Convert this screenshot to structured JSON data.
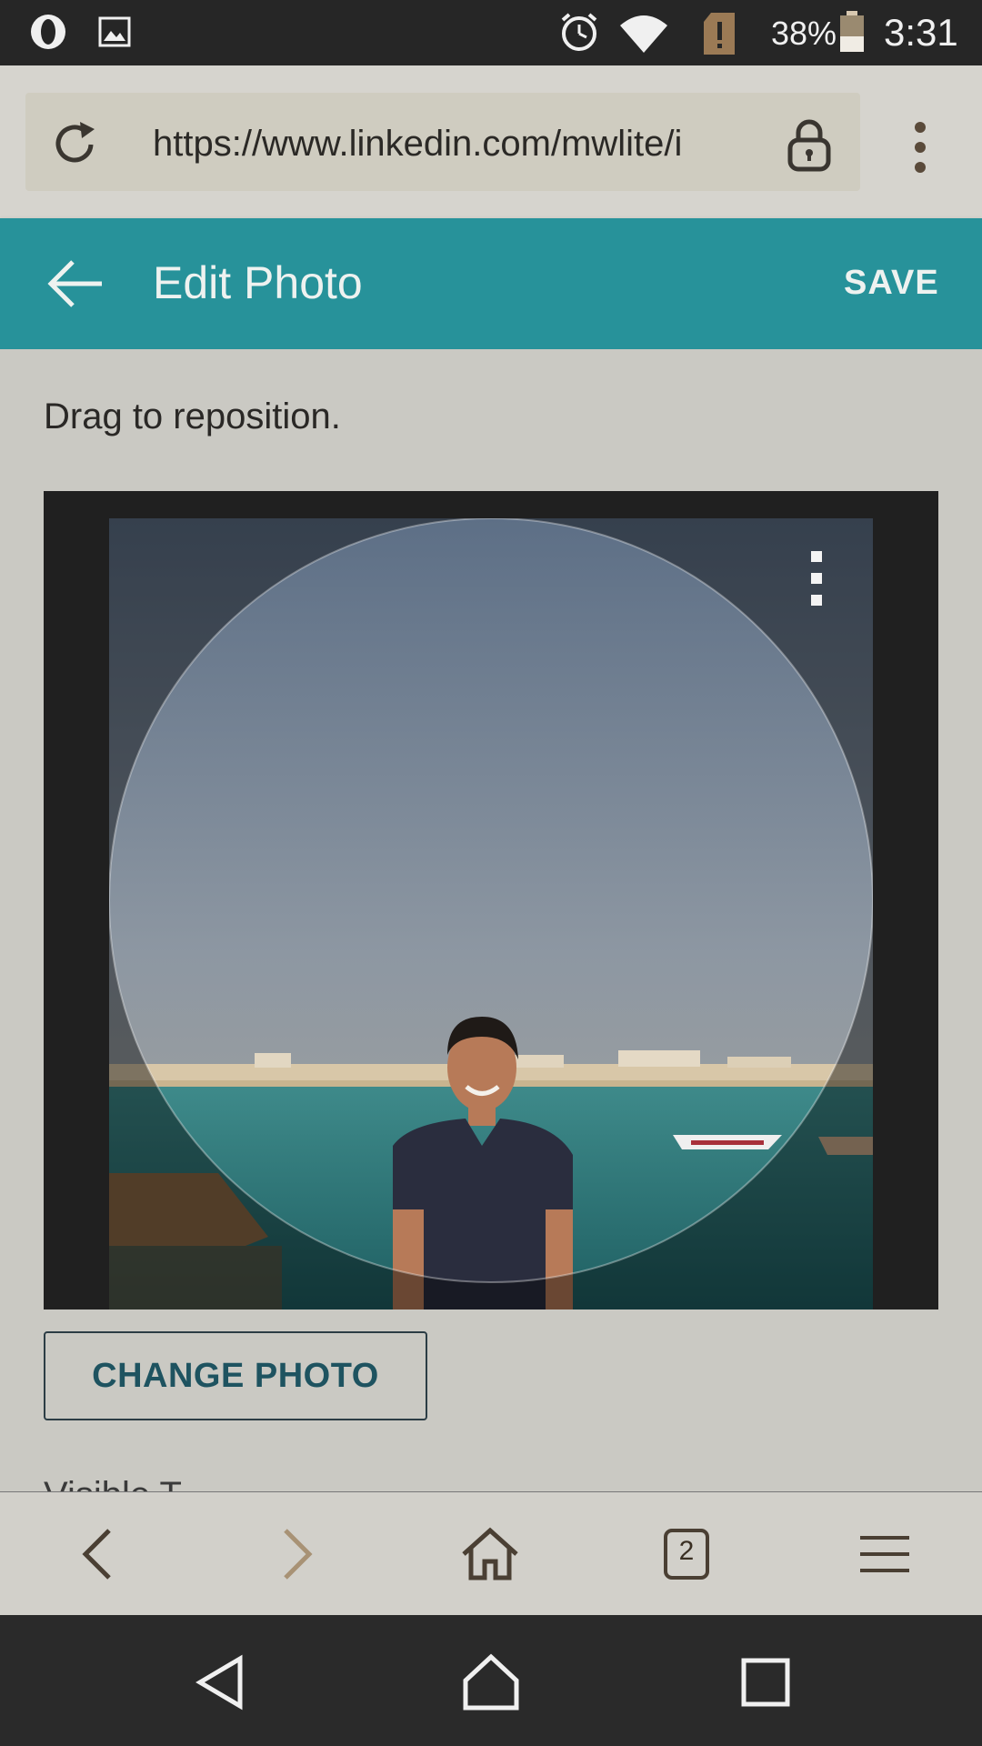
{
  "status_bar": {
    "battery_percent": "38%",
    "time": "3:31",
    "icons": [
      "opera-icon",
      "gallery-icon",
      "alarm-icon",
      "wifi-icon",
      "sim-alert-icon",
      "battery-icon"
    ]
  },
  "browser": {
    "url": "https://www.linkedin.com/mwlite/i",
    "tab_count": "2",
    "icons": [
      "reload-icon",
      "lock-icon",
      "more-vert-icon",
      "nav-back-icon",
      "nav-forward-icon",
      "home-icon",
      "tabs-icon",
      "menu-icon"
    ]
  },
  "header": {
    "title": "Edit Photo",
    "save_label": "SAVE"
  },
  "content": {
    "hint": "Drag to reposition.",
    "change_photo_label": "CHANGE PHOTO",
    "visible_to_label": "Visible T"
  },
  "colors": {
    "header_bg": "#27929a",
    "status_bg": "#262626",
    "button_text": "#1e5360"
  },
  "android_nav": {
    "icons": [
      "system-back-icon",
      "system-home-icon",
      "system-recents-icon"
    ]
  }
}
